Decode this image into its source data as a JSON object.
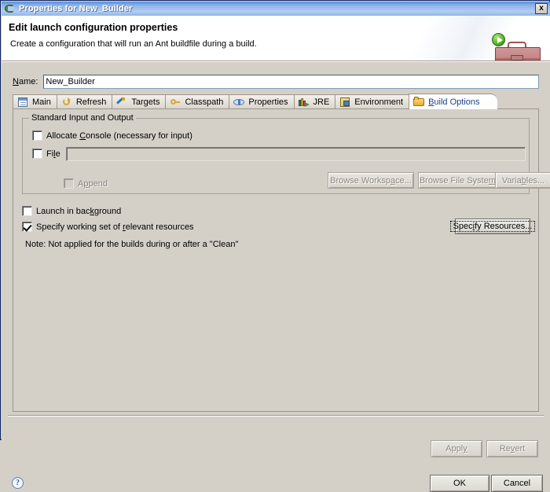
{
  "window": {
    "title": "Properties for New_Builder",
    "title_icon": "eclipse-icon",
    "close_label": "x"
  },
  "banner": {
    "title": "Edit launch configuration properties",
    "subtitle": "Create a configuration that will run an Ant buildfile during a build.",
    "icon": "toolbox-with-run-icon"
  },
  "name_field": {
    "label": "Name:",
    "value": "New_Builder"
  },
  "tabs": [
    {
      "label": "Main",
      "icon": "main-document-icon",
      "selected": false
    },
    {
      "label": "Refresh",
      "icon": "refresh-arrows-icon",
      "selected": false
    },
    {
      "label": "Targets",
      "icon": "targets-check-icon",
      "selected": false
    },
    {
      "label": "Classpath",
      "icon": "classpath-link-icon",
      "selected": false
    },
    {
      "label": "Properties",
      "icon": "properties-oval-icon",
      "selected": false
    },
    {
      "label": "JRE",
      "icon": "jre-books-icon",
      "selected": false
    },
    {
      "label": "Environment",
      "icon": "environment-icon",
      "selected": false
    },
    {
      "label": "Build Options",
      "icon": "folder-icon",
      "selected": true
    }
  ],
  "build_options": {
    "group_title": "Standard Input and Output",
    "allocate_console": {
      "label_pre": "Allocate ",
      "label_mnemonic": "C",
      "label_post": "onsole (necessary for input)",
      "checked": false,
      "enabled": true
    },
    "file": {
      "label_pre": "Fi",
      "label_mnemonic": "l",
      "label_post": "e",
      "checked": false,
      "enabled": true,
      "value": ""
    },
    "append": {
      "label_pre": "A",
      "label_mnemonic": "p",
      "label_post": "pend",
      "checked": false,
      "enabled": false
    },
    "browse_workspace": {
      "label_pre": "Browse Worksp",
      "label_mnemonic": "a",
      "label_post": "ce...",
      "enabled": false
    },
    "browse_filesystem": {
      "label_pre": "Browse File Syste",
      "label_mnemonic": "m",
      "label_post": "...",
      "enabled": false
    },
    "variables": {
      "label_pre": "Varia",
      "label_mnemonic": "b",
      "label_post": "les...",
      "enabled": false
    },
    "launch_in_background": {
      "label_pre": "Launch in bac",
      "label_mnemonic": "k",
      "label_post": "ground",
      "checked": false,
      "enabled": true
    },
    "specify_working_set": {
      "label_pre": "Specify working set of ",
      "label_mnemonic": "r",
      "label_post": "elevant resources",
      "checked": true,
      "enabled": true
    },
    "specify_resources_button": {
      "label_pre": "Spec",
      "label_mnemonic": "i",
      "label_post": "fy Resources...",
      "enabled": true,
      "focused": true
    },
    "note": "Note: Not applied for the builds during or after a \"Clean\""
  },
  "footer": {
    "apply": {
      "label_pre": "Appl",
      "label_mnemonic": "y",
      "label_post": "",
      "enabled": false
    },
    "revert": {
      "label_pre": "Re",
      "label_mnemonic": "v",
      "label_post": "ert",
      "enabled": false
    },
    "ok": {
      "label": "OK",
      "enabled": true
    },
    "cancel": {
      "label": "Cancel",
      "enabled": true
    },
    "help_icon": "help-question-icon",
    "help_glyph": "?"
  }
}
